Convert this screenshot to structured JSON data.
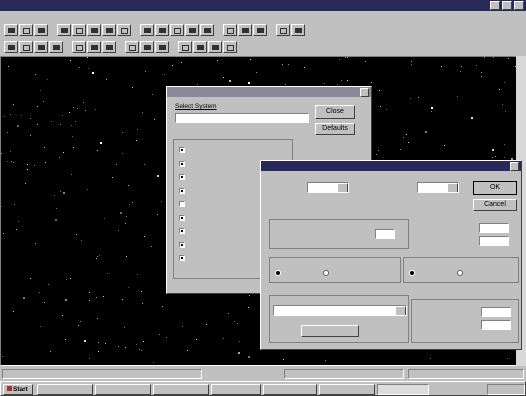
{
  "app": {
    "title": ""
  },
  "menu": [
    "",
    "",
    "",
    "",
    "",
    "",
    "",
    ""
  ],
  "toolbar1": [
    {
      "icon": "open-folder-icon"
    },
    {
      "icon": "save-icon"
    },
    {
      "icon": "print-icon"
    },
    {
      "icon": "cut-icon"
    },
    {
      "icon": "copy-icon"
    },
    {
      "icon": "paste-icon"
    },
    {
      "icon": "undo-icon"
    },
    {
      "icon": "redo-icon"
    },
    {
      "icon": "zoom-in-icon"
    },
    {
      "icon": "zoom-out-icon"
    },
    {
      "icon": "grid-icon"
    },
    {
      "icon": "stars-icon"
    },
    {
      "icon": "planets-icon"
    },
    {
      "icon": "constellation-icon"
    },
    {
      "icon": "telescope-icon"
    },
    {
      "icon": "find-icon"
    },
    {
      "icon": "settings-icon"
    },
    {
      "icon": "chart-icon"
    }
  ],
  "toolbar2": [
    {
      "icon": "arrow-up-icon"
    },
    {
      "icon": "arrow-down-icon"
    },
    {
      "icon": "arrow-left-icon"
    },
    {
      "icon": "arrow-right-icon"
    },
    {
      "icon": "rotate-left-icon"
    },
    {
      "icon": "rotate-right-icon"
    },
    {
      "icon": "center-icon"
    },
    {
      "icon": "zoom-box-icon"
    },
    {
      "icon": "label-icon"
    },
    {
      "icon": "text-icon"
    },
    {
      "icon": "track-icon"
    },
    {
      "icon": "field-icon"
    },
    {
      "icon": "ecliptic-icon"
    },
    {
      "icon": "horizon-icon"
    }
  ],
  "dialog_back": {
    "title": "",
    "section_label": "Select System",
    "field_value": "",
    "close_label": "Close",
    "defaults_label": "Defaults",
    "group_label": "",
    "options": [
      {
        "label": "",
        "checked": true
      },
      {
        "label": "",
        "checked": true
      },
      {
        "label": "",
        "checked": true
      },
      {
        "label": "",
        "checked": true
      },
      {
        "label": "",
        "checked": false
      },
      {
        "label": "",
        "checked": true
      },
      {
        "label": "",
        "checked": true
      },
      {
        "label": "",
        "checked": true
      },
      {
        "label": "",
        "checked": true
      }
    ],
    "footer_text": ""
  },
  "dialog_front": {
    "title": "",
    "field1_label": "",
    "field1_value": "",
    "field2_label": "",
    "field2_value": "",
    "ok_label": "OK",
    "cancel_label": "Cancel",
    "group1_label": "",
    "item_label": "",
    "item_value": "",
    "right_rows": [
      {
        "label": "",
        "value": ""
      },
      {
        "label": "",
        "value": ""
      }
    ],
    "group2_label": "",
    "radio_a": {
      "opt1": "",
      "opt2": ""
    },
    "group3_label": "",
    "radio_b": {
      "opt1": "",
      "opt2": ""
    },
    "group4_label": "",
    "dropdown_value": "",
    "btn_label": "",
    "group5_label": "",
    "bottom_rows": [
      {
        "label": "",
        "value": ""
      },
      {
        "label": "",
        "value": ""
      }
    ]
  },
  "status": {
    "left": "",
    "mid": "",
    "right": ""
  },
  "taskbar": {
    "start": "Start",
    "items": [
      "",
      "",
      "",
      "",
      "",
      "",
      ""
    ],
    "clock": ""
  },
  "colors": {
    "sky": "#000000",
    "title_active": "#28285a",
    "title_inactive": "#8a8a9a",
    "desktop": "#c0c0c0"
  }
}
